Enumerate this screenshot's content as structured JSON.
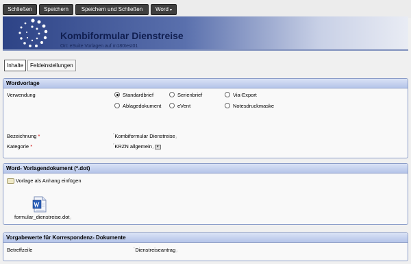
{
  "toolbar": {
    "close_label": "Schließen",
    "save_label": "Speichern",
    "save_close_label": "Speichern und Schließen",
    "word_label": "Word",
    "word_caret": "▾"
  },
  "header": {
    "title": "Kombiformular Dienstreise",
    "subtitle": "Ort: eSuite Vorlagen auf m180test01"
  },
  "tabs": [
    {
      "label": "Inhalte",
      "active": true
    },
    {
      "label": "Feldeinstellungen",
      "active": false
    }
  ],
  "wordvorlage": {
    "heading": "Wordvorlage",
    "verwendung_label": "Verwendung",
    "options": [
      {
        "label": "Standardbrief",
        "checked": true
      },
      {
        "label": "Serienbrief",
        "checked": false
      },
      {
        "label": "Via-Export",
        "checked": false
      },
      {
        "label": "Ablagedokument",
        "checked": false
      },
      {
        "label": "eVent",
        "checked": false
      },
      {
        "label": "Notesdruckmaske",
        "checked": false
      }
    ],
    "bezeichnung_label": "Bezeichnung",
    "bezeichnung_value": "Kombiformular Dienstreise",
    "kategorie_label": "Kategorie",
    "kategorie_value": "KRZN allgemein",
    "required_marker": "*",
    "field_open_marker": "⌜",
    "field_close_marker": "⌟",
    "dropdown_glyph": "▾"
  },
  "dokument": {
    "heading": "Word- Vorlagendokument (*.dot)",
    "attach_label": "Vorlage als Anhang einfügen",
    "file_name": "formular_dienstreise.dot"
  },
  "korrespondenz": {
    "heading": "Vorgabewerte für Korrespondenz- Dokumente",
    "betreff_label": "Betreffzeile",
    "betreff_value": "Dienstreiseantrag"
  },
  "colors": {
    "header_dark": "#2d4386",
    "panel_head": "#b5c4e9",
    "required": "#cc0000",
    "word_blue": "#2b5fb8"
  }
}
